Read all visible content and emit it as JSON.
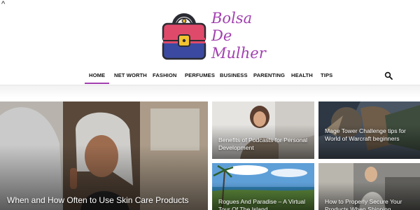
{
  "logo": {
    "line1": "Bolsa",
    "line2": "De",
    "line3": "Mulher",
    "bag_color": "#e04a6a",
    "text_color": "#a23fb0"
  },
  "nav": {
    "items": [
      "HOME",
      "NET WORTH",
      "FASHION",
      "PERFUMES",
      "BUSINESS",
      "PARENTING",
      "HEALTH",
      "TIPS"
    ],
    "active": "HOME",
    "accent": "#a23fb0"
  },
  "icons": {
    "search": "search-icon",
    "caret": "caret-up-icon"
  },
  "caret": "^",
  "articles": {
    "main": {
      "title": "When and How Often to Use Skin Care Products"
    },
    "podcast": {
      "title": "Benefits of Podcasts for Personal Development"
    },
    "warcraft": {
      "title": "Mage Tower Challenge tips for World of Warcraft beginners"
    },
    "island": {
      "title": "Rogues And Paradise – A Virtual Tour Of The Island"
    },
    "shipping": {
      "title": "How to Properly Secure Your Products When Shipping"
    }
  }
}
